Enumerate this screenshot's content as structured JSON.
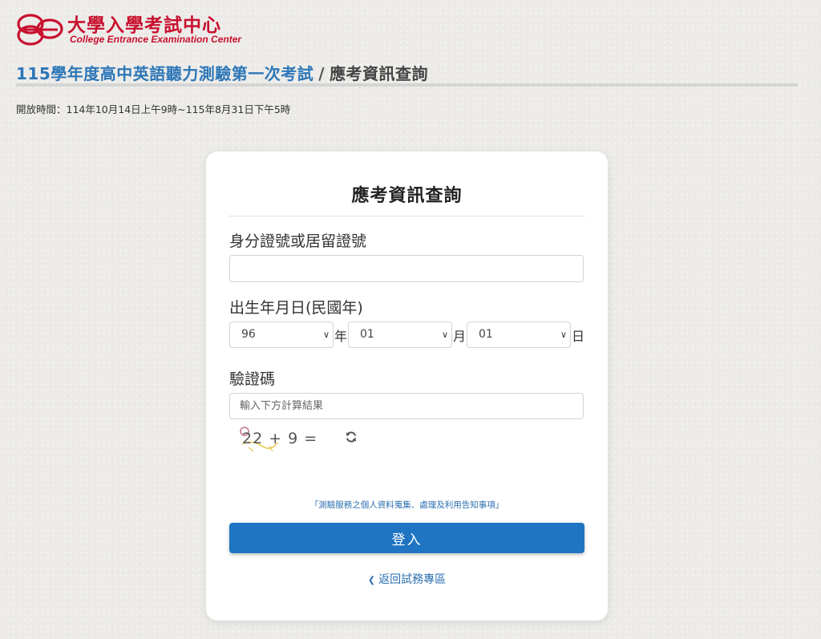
{
  "logo": {
    "name_cn": "大學入學考試中心",
    "name_en": "College Entrance Examination Center"
  },
  "header": {
    "exam_title": "115學年度高中英語聽力測驗第一次考試",
    "separator": "/",
    "page_title": "應考資訊查詢"
  },
  "open_time": "開放時間：114年10月14日上午9時~115年8月31日下午5時",
  "form": {
    "title": "應考資訊查詢",
    "id_label": "身分證號或居留證號",
    "id_value": "",
    "birth_label": "出生年月日(民國年)",
    "year_value": "96",
    "year_unit": "年",
    "month_value": "01",
    "month_unit": "月",
    "day_value": "01",
    "day_unit": "日",
    "captcha_label": "驗證碼",
    "captcha_placeholder": "輸入下方計算結果",
    "captcha_text": "22 + 9 =",
    "privacy_link": "「測驗服務之個人資料蒐集、處理及利用告知事項」",
    "login_button": "登入",
    "back_link": "返回試務專區"
  },
  "colors": {
    "brand_red": "#c8102e",
    "title_blue": "#2c76b8",
    "button_blue": "#1f75c2",
    "link_blue": "#2c6fb0"
  },
  "icons": {
    "refresh": "refresh-icon",
    "chevron_left": "chevron-left-icon",
    "chevron_down": "chevron-down-icon"
  }
}
